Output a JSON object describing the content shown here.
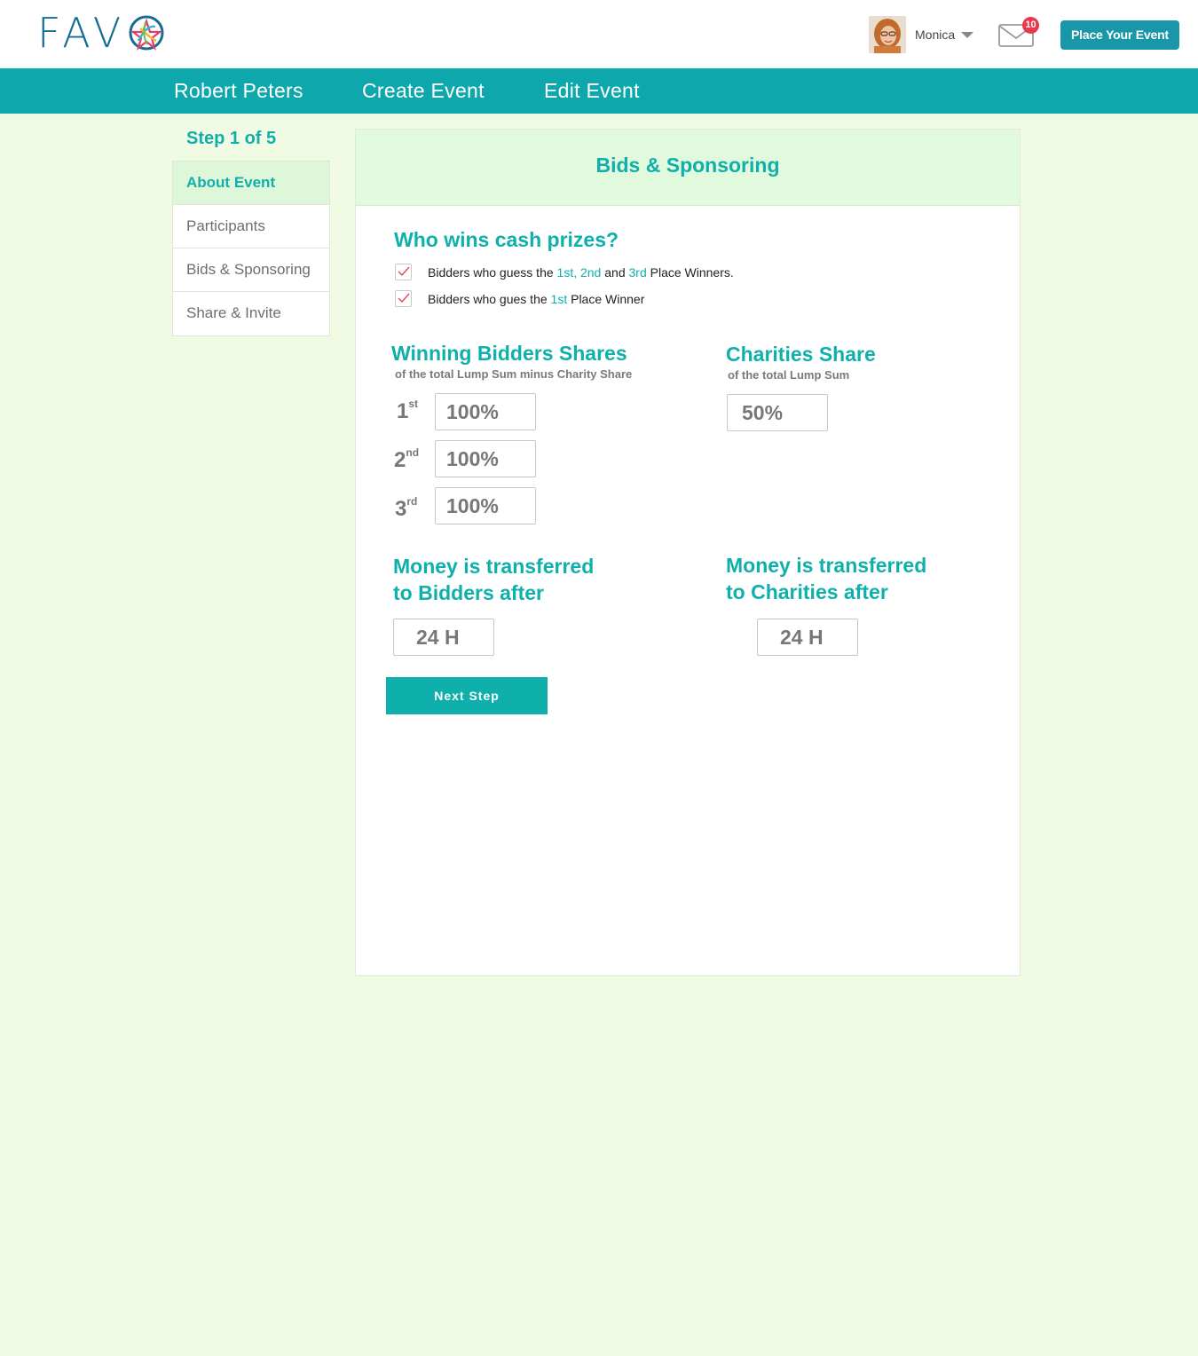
{
  "header": {
    "logo_text": "FAV",
    "user_name": "Monica",
    "mail_count": "10",
    "place_event_label": "Place Your Event"
  },
  "nav": {
    "items": [
      "Robert Peters",
      "Create Event",
      "Edit Event"
    ]
  },
  "sidebar": {
    "step_label": "Step 1 of 5",
    "items": [
      {
        "label": "About Event",
        "active": true
      },
      {
        "label": "Participants",
        "active": false
      },
      {
        "label": "Bids & Sponsoring",
        "active": false
      },
      {
        "label": "Share & Invite",
        "active": false
      }
    ]
  },
  "panel": {
    "title": "Bids & Sponsoring",
    "question": "Who wins cash prizes?",
    "options": [
      {
        "pre": "Bidders who guess the ",
        "hl1": "1st, 2nd",
        "mid": " and ",
        "hl2": "3rd",
        "post": " Place Winners.",
        "checked": true
      },
      {
        "pre": "Bidders who gues the ",
        "hl1": "1st",
        "post": " Place Winner",
        "checked": true
      }
    ],
    "bidders": {
      "title": "Winning Bidders Shares",
      "subtitle": "of the total Lump Sum minus Charity Share",
      "places": [
        {
          "num": "1",
          "suffix": "st",
          "value": "100%"
        },
        {
          "num": "2",
          "suffix": "nd",
          "value": "100%"
        },
        {
          "num": "3",
          "suffix": "rd",
          "value": "100%"
        }
      ]
    },
    "charities": {
      "title": "Charities Share",
      "subtitle": "of the total Lump Sum",
      "value": "50%"
    },
    "transfer_bidders": {
      "line1": "Money is transferred",
      "line2": "to Bidders after",
      "value": "24 H"
    },
    "transfer_charities": {
      "line1": "Money is transferred",
      "line2": "to Charities after",
      "value": "24 H"
    },
    "next_label": "Next Step"
  },
  "colors": {
    "accent": "#0fb0ab",
    "nav": "#0ea8ac",
    "brand_button": "#1a96a9",
    "background": "#f1fae2",
    "badge": "#e8384a"
  }
}
